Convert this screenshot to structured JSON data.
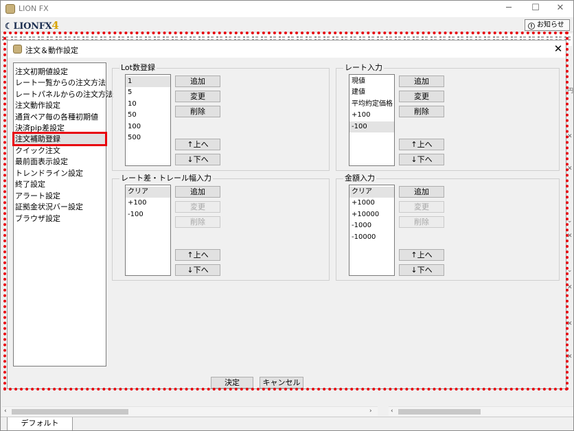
{
  "app": {
    "title": "LION FX",
    "brand": "LIONFX",
    "brand_version": "4",
    "notice_label": "お知らせ",
    "minimize": "─",
    "maximize": "☐",
    "close": "✕",
    "default_tab": "デフォルト"
  },
  "dialog": {
    "title": "注文＆動作設定",
    "close": "✕",
    "ok_label": "決定",
    "cancel_label": "キャンセル",
    "nav": [
      "注文初期値設定",
      "レート一覧からの注文方法",
      "レートパネルからの注文方法",
      "注文動作設定",
      "通貨ペア毎の各種初期値",
      "決済pip差設定",
      "注文補助登録",
      "クイック注文",
      "最前面表示設定",
      "トレンドライン設定",
      "終了設定",
      "アラート設定",
      "証拠金状況バー設定",
      "ブラウザ設定"
    ],
    "selected_nav": "注文補助登録",
    "lot_group": {
      "title": "Lot数登録",
      "items": [
        "1",
        "5",
        "10",
        "50",
        "100",
        "500"
      ],
      "selected": "1",
      "add": "追加",
      "change": "変更",
      "delete": "削除",
      "up": "↑上へ",
      "down": "↓下へ"
    },
    "rate_group": {
      "title": "レート入力",
      "items": [
        "現値",
        "建値",
        "平均約定価格",
        "+100",
        "-100"
      ],
      "selected": "-100",
      "add": "追加",
      "change": "変更",
      "delete": "削除",
      "up": "↑上へ",
      "down": "↓下へ"
    },
    "trail_group": {
      "title": "レート差・トレール幅入力",
      "items": [
        "クリア",
        "+100",
        "-100"
      ],
      "selected": "クリア",
      "add": "追加",
      "change": "変更",
      "delete": "削除",
      "up": "↑上へ",
      "down": "↓下へ"
    },
    "amount_group": {
      "title": "金額入力",
      "items": [
        "クリア",
        "+1000",
        "+10000",
        "-1000",
        "-10000"
      ],
      "selected": "クリア",
      "add": "追加",
      "change": "変更",
      "delete": "削除",
      "up": "↑上へ",
      "down": "↓下へ"
    }
  }
}
